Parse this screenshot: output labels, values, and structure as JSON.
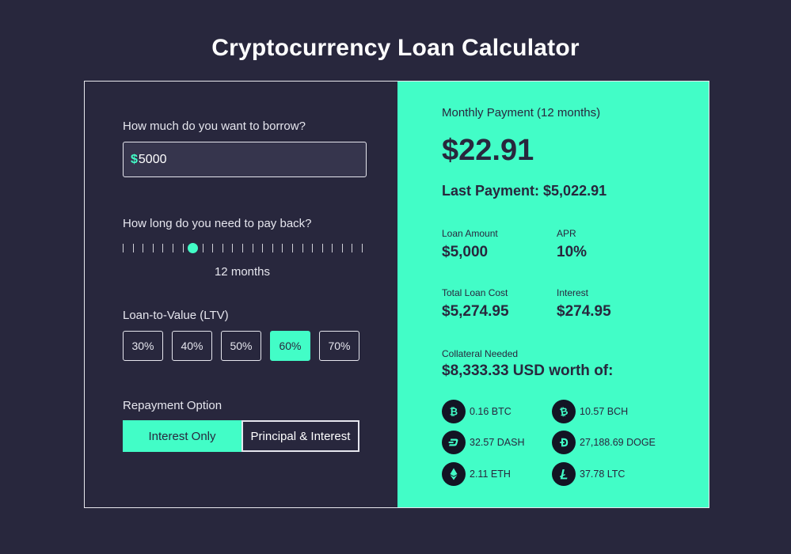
{
  "page_title": "Cryptocurrency Loan Calculator",
  "borrow": {
    "label": "How much do you want to borrow?",
    "currency_symbol": "$",
    "value": "5000"
  },
  "term": {
    "label": "How long do you need to pay back?",
    "ticks": 25,
    "selected_tick_index": 7,
    "value_text": "12 months"
  },
  "ltv": {
    "label": "Loan-to-Value (LTV)",
    "options": [
      "30%",
      "40%",
      "50%",
      "60%",
      "70%"
    ],
    "selected": "60%"
  },
  "repayment": {
    "label": "Repayment Option",
    "options": [
      "Interest Only",
      "Principal & Interest"
    ],
    "selected": "Interest Only"
  },
  "results": {
    "monthly_label": "Monthly Payment (12 months)",
    "monthly_value": "$22.91",
    "last_payment": "Last Payment: $5,022.91",
    "loan_amount_label": "Loan Amount",
    "loan_amount_value": "$5,000",
    "apr_label": "APR",
    "apr_value": "10%",
    "total_cost_label": "Total Loan Cost",
    "total_cost_value": "$5,274.95",
    "interest_label": "Interest",
    "interest_value": "$274.95",
    "collateral_label": "Collateral Needed",
    "collateral_value": "$8,333.33 USD worth of:"
  },
  "collateral_coins": [
    {
      "icon": "bitcoin-icon",
      "text": "0.16 BTC"
    },
    {
      "icon": "bitcoin-cash-icon",
      "text": "10.57 BCH"
    },
    {
      "icon": "dash-icon",
      "text": "32.57 DASH"
    },
    {
      "icon": "dogecoin-icon",
      "text": "27,188.69 DOGE"
    },
    {
      "icon": "ethereum-icon",
      "text": "2.11 ETH"
    },
    {
      "icon": "litecoin-icon",
      "text": "37.78 LTC"
    }
  ],
  "colors": {
    "background": "#28273d",
    "accent": "#42fdc7",
    "text_dark": "#28273d",
    "coin_icon_bg": "#131424"
  }
}
